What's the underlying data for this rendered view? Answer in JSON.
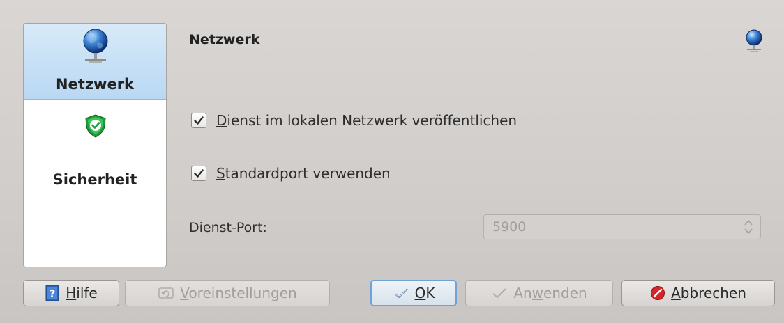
{
  "sidebar": {
    "items": [
      {
        "label": "Netzwerk",
        "icon": "network-globe-icon",
        "selected": true
      },
      {
        "label": "Sicherheit",
        "icon": "security-shield-icon",
        "selected": false
      }
    ]
  },
  "page": {
    "title": "Netzwerk",
    "options": [
      {
        "mnemonic": "D",
        "rest": "ienst im lokalen Netzwerk veröffentlichen",
        "checked": true
      },
      {
        "mnemonic": "S",
        "rest": "tandardport verwenden",
        "checked": true
      }
    ],
    "port": {
      "label_pre": "Dienst-",
      "label_mnemonic": "P",
      "label_post": "ort:",
      "value": "5900",
      "enabled": false
    }
  },
  "buttons": {
    "help": {
      "mnemonic": "H",
      "rest": "ilfe",
      "icon": "help-book-icon"
    },
    "defaults": {
      "mnemonic": "V",
      "rest": "oreinstellungen",
      "icon": "restore-defaults-icon",
      "enabled": false
    },
    "ok": {
      "mnemonic": "O",
      "rest": "K",
      "icon": "checkmark-icon",
      "default": true
    },
    "apply": {
      "pre": "An",
      "mnemonic": "w",
      "rest": "enden",
      "icon": "checkmark-icon",
      "enabled": false
    },
    "cancel": {
      "mnemonic": "A",
      "rest": "bbrechen",
      "icon": "cancel-icon"
    }
  },
  "colors": {
    "selection": "#b9d8f3",
    "default_button_border": "#6fa2d6",
    "cancel_red": "#d7262b",
    "shield_green": "#1f9a3a"
  }
}
